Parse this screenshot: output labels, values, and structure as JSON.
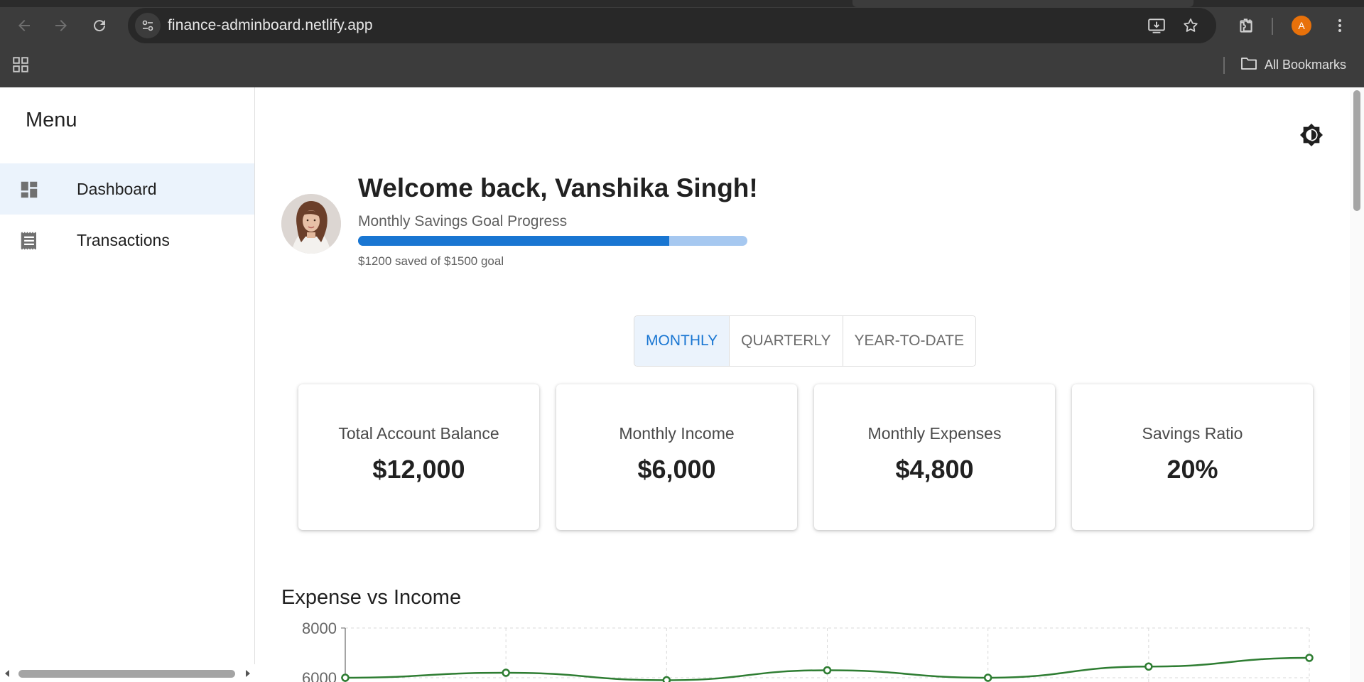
{
  "browser": {
    "url": "finance-adminboard.netlify.app",
    "profile_initial": "A",
    "bookmarks_label": "All Bookmarks",
    "icons": [
      "back-icon",
      "forward-icon",
      "reload-icon",
      "site-info-icon",
      "install-app-icon",
      "star-icon",
      "extensions-icon",
      "menu-icon",
      "apps-grid-icon",
      "folder-icon"
    ]
  },
  "sidebar": {
    "title": "Menu",
    "items": [
      {
        "label": "Dashboard",
        "icon": "dashboard-icon",
        "active": true
      },
      {
        "label": "Transactions",
        "icon": "receipt-icon",
        "active": false
      }
    ]
  },
  "header": {
    "welcome": "Welcome back, Vanshika Singh!",
    "goal_label": "Monthly Savings Goal Progress",
    "goal_caption": "$1200 saved of $1500 goal",
    "goal_progress": 0.8,
    "theme_icon": "brightness-icon"
  },
  "period_toggle": {
    "options": [
      "MONTHLY",
      "QUARTERLY",
      "YEAR-TO-DATE"
    ],
    "selected": "MONTHLY"
  },
  "stats": [
    {
      "label": "Total Account Balance",
      "value": "$12,000"
    },
    {
      "label": "Monthly Income",
      "value": "$6,000"
    },
    {
      "label": "Monthly Expenses",
      "value": "$4,800"
    },
    {
      "label": "Savings Ratio",
      "value": "20%"
    }
  ],
  "chart_section": {
    "title": "Expense vs Income"
  },
  "chart_data": {
    "type": "line",
    "title": "Expense vs Income",
    "yticks": [
      8000,
      6000
    ],
    "grid": true,
    "series": [
      {
        "color": "#2e7d32",
        "values": [
          6000,
          6200,
          5900,
          6300,
          6000,
          6450,
          6800
        ]
      }
    ]
  },
  "colors": {
    "accent": "#1976d2",
    "accent_light": "#a6c8f0",
    "active_bg": "#ebf3fc",
    "chart_line": "#2e7d32"
  }
}
